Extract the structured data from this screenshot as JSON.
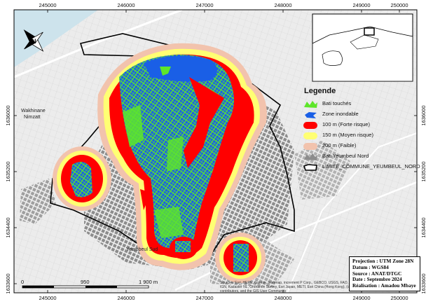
{
  "map": {
    "x_ticks": [
      "245000",
      "246000",
      "247000",
      "248000",
      "249000",
      "250000"
    ],
    "y_ticks": [
      "1636000",
      "1635200",
      "1634400",
      "1633600"
    ],
    "places": [
      "Wakhinane\nNimzatt",
      "Yeumbeul Sud"
    ],
    "credits": [
      "Sources: Esri, HERE, Garmin, Intermap, increment P Corp., GEBCO, USGS, FAO, NPS, NRCAN, GeoBase,",
      "IGN, Kadaster NL, Ordnance Survey, Esri Japan, METI, Esri China (Hong Kong), (c) OpenStreetMap",
      "contributors, and the GIS User Community"
    ],
    "colors": {
      "bati_touches": "#5ee62a",
      "zone_inondable": "#1a5fe6",
      "buffer_100": "#ff0000",
      "buffer_150": "#ffff73",
      "buffer_200": "#f2c3ad",
      "bati_yeumbeul": "#8c8c8c",
      "limite": "#000000",
      "basemap": "#ececec"
    }
  },
  "legend": {
    "title": "Legende",
    "items": [
      {
        "label": "Bati touchés",
        "symbol": "bati-touches"
      },
      {
        "label": "Zone inondable",
        "symbol": "zone-inondable"
      },
      {
        "label": "100 m (Forte risque)",
        "symbol": "buffer-100"
      },
      {
        "label": "150 m (Moyen risque)",
        "symbol": "buffer-150"
      },
      {
        "label": "200 m (Faible)",
        "symbol": "buffer-200"
      },
      {
        "label": "Bati Yeumbeul Nord",
        "symbol": "bati-yeumbeul"
      },
      {
        "label": "LIMITE_COMMUNE_YEUMBEUL_NORD",
        "symbol": "limite"
      }
    ]
  },
  "scale": {
    "labels": [
      "0",
      "950",
      "1 900 m"
    ]
  },
  "info": {
    "projection": "Projection : UTM Zone 28N",
    "datum": "Datum : WGS84",
    "source": "Source : ANAT/DTGC",
    "date": "Date : Septembre 2024",
    "realisation": "Réalisation : Amadou Mbaye"
  }
}
